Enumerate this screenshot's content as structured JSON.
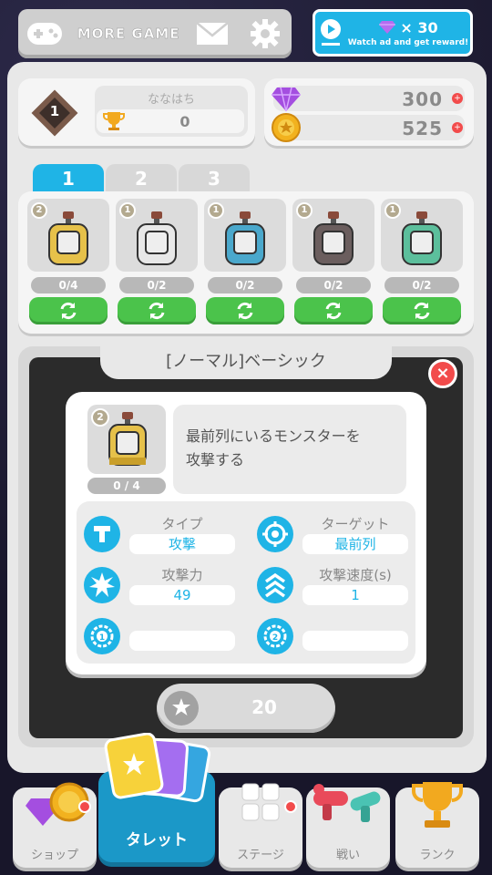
{
  "topbar": {
    "more_game": "MORE GAME",
    "ad_count": "× 30",
    "ad_label": "Watch ad and get reward!"
  },
  "profile": {
    "rank": "1",
    "name": "ななはち",
    "trophies": "0"
  },
  "currency": {
    "gems": "300",
    "coins": "525"
  },
  "tabs": [
    {
      "label": "1",
      "active": true
    },
    {
      "label": "2",
      "active": false
    },
    {
      "label": "3",
      "active": false
    }
  ],
  "turrets": [
    {
      "level": "2",
      "progress": "0/4",
      "color": "#e6c14a"
    },
    {
      "level": "1",
      "progress": "0/2",
      "color": "#e8e8e8"
    },
    {
      "level": "1",
      "progress": "0/2",
      "color": "#4aa8cc"
    },
    {
      "level": "1",
      "progress": "0/2",
      "color": "#6b5e5e"
    },
    {
      "level": "1",
      "progress": "0/2",
      "color": "#5cbf9c"
    }
  ],
  "detail": {
    "title": "[ノーマル]ベーシック",
    "close": "×",
    "level": "2",
    "progress": "0 / 4",
    "description_line1": "最前列にいるモンスターを",
    "description_line2": "攻撃する",
    "stats": {
      "type_label": "タイプ",
      "type_value": "攻撃",
      "target_label": "ターゲット",
      "target_value": "最前列",
      "power_label": "攻撃力",
      "power_value": "49",
      "speed_label": "攻撃速度(s)",
      "speed_value": "1",
      "slot1_value": "",
      "slot2_value": ""
    },
    "cost": "20"
  },
  "nav": {
    "shop": "ショップ",
    "turret": "タレット",
    "stage": "ステージ",
    "battle": "戦い",
    "rank": "ランク"
  },
  "colors": {
    "accent": "#1fb4e6",
    "upgrade_green": "#4bc34b",
    "alert_red": "#f24b4b"
  }
}
